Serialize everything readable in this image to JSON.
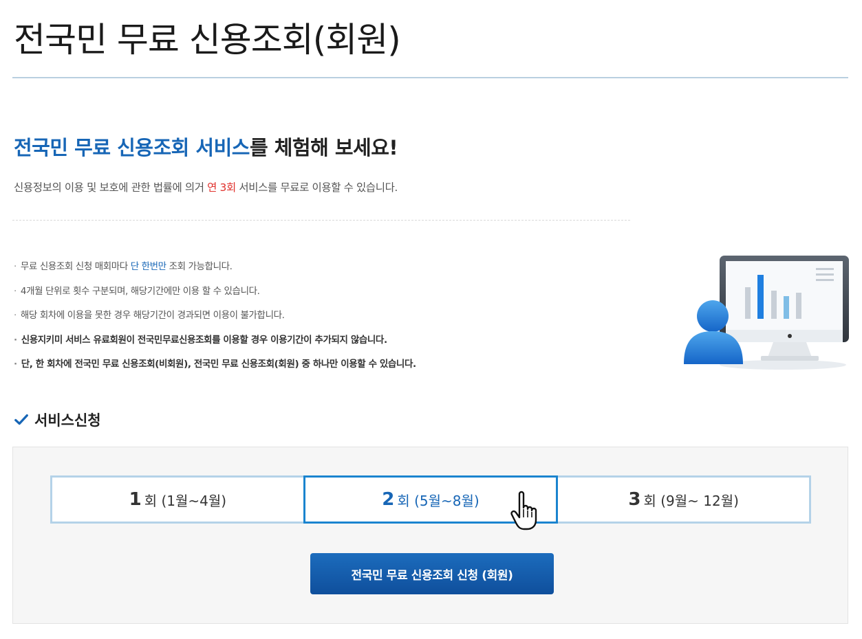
{
  "page": {
    "title": "전국민 무료 신용조회(회원)"
  },
  "intro": {
    "headline_highlight": "전국민 무료 신용조회 서비스",
    "headline_rest": "를 체험해 보세요!",
    "lead_before": "신용정보의 이용 및 보호에 관한 법률에 의거 ",
    "lead_highlight": "연 3회",
    "lead_after": " 서비스를 무료로 이용할 수 있습니다."
  },
  "notes": {
    "n1_before": "무료 신용조회 신청 매회마다 ",
    "n1_highlight": "단 한번만",
    "n1_after": " 조회 가능합니다.",
    "n2": "4개월 단위로 횟수 구분되며, 해당기간에만 이용 할 수 있습니다.",
    "n3": "해당 회차에 이용을 못한 경우 해당기간이 경과되면 이용이 불가합니다.",
    "n4": "신용지키미 서비스 유료회원이 전국민무료신용조회를 이용할 경우 이용기간이 추가되지 않습니다.",
    "n5": "단, 한 회차에 전국민 무료 신용조회(비회원), 전국민 무료 신용조회(회원) 중 하나만 이용할 수 있습니다."
  },
  "section": {
    "title": "서비스신청",
    "icon": "check-icon"
  },
  "rounds": [
    {
      "num": "1",
      "label": "회 (1월~4월)",
      "active": false
    },
    {
      "num": "2",
      "label": "회 (5월~8월)",
      "active": true
    },
    {
      "num": "3",
      "label": "회 (9월~ 12월)",
      "active": false
    }
  ],
  "apply_button": {
    "label": "전국민 무료 신용조회 신청 (회원)"
  },
  "colors": {
    "accent": "#1766b6",
    "highlight_red": "#e0302b",
    "tab_border": "#b4d2e8",
    "tab_active_border": "#1a84cf",
    "button": "#1560b0"
  }
}
